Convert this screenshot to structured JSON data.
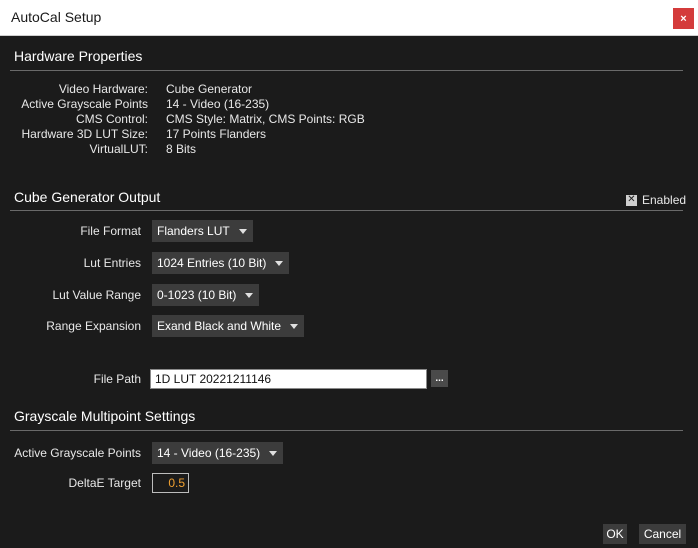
{
  "window": {
    "title": "AutoCal Setup",
    "close_label": "×"
  },
  "hardware": {
    "title": "Hardware Properties",
    "rows": [
      {
        "label": "Video Hardware:",
        "value": "Cube Generator"
      },
      {
        "label": "Active Grayscale Points",
        "value": "14 - Video (16-235)"
      },
      {
        "label": "CMS Control:",
        "value": "CMS Style: Matrix, CMS Points: RGB"
      },
      {
        "label": "Hardware 3D LUT Size:",
        "value": "17 Points Flanders"
      },
      {
        "label": "VirtualLUT:",
        "value": "8 Bits"
      }
    ]
  },
  "cube_output": {
    "title": "Cube Generator Output",
    "enabled_label": "Enabled",
    "enabled_checked": true,
    "enabled_mark": "✕",
    "file_format": {
      "label": "File Format",
      "value": "Flanders LUT"
    },
    "lut_entries": {
      "label": "Lut Entries",
      "value": "1024 Entries (10 Bit)"
    },
    "lut_value_range": {
      "label": "Lut Value Range",
      "value": "0-1023 (10 Bit)"
    },
    "range_expansion": {
      "label": "Range Expansion",
      "value": "Exand Black and White"
    },
    "file_path": {
      "label": "File Path",
      "value": "1D LUT 20221211146",
      "browse_label": "..."
    }
  },
  "grayscale": {
    "title": "Grayscale Multipoint Settings",
    "active_points": {
      "label": "Active Grayscale Points",
      "value": "14 - Video (16-235)"
    },
    "deltae": {
      "label": "DeltaE Target",
      "value": "0.5"
    }
  },
  "buttons": {
    "ok": "OK",
    "cancel": "Cancel"
  },
  "colors": {
    "background": "#1b1b1b",
    "control": "#3c3c3c",
    "close": "#d43b3b",
    "deltae_value": "#f0a030"
  }
}
